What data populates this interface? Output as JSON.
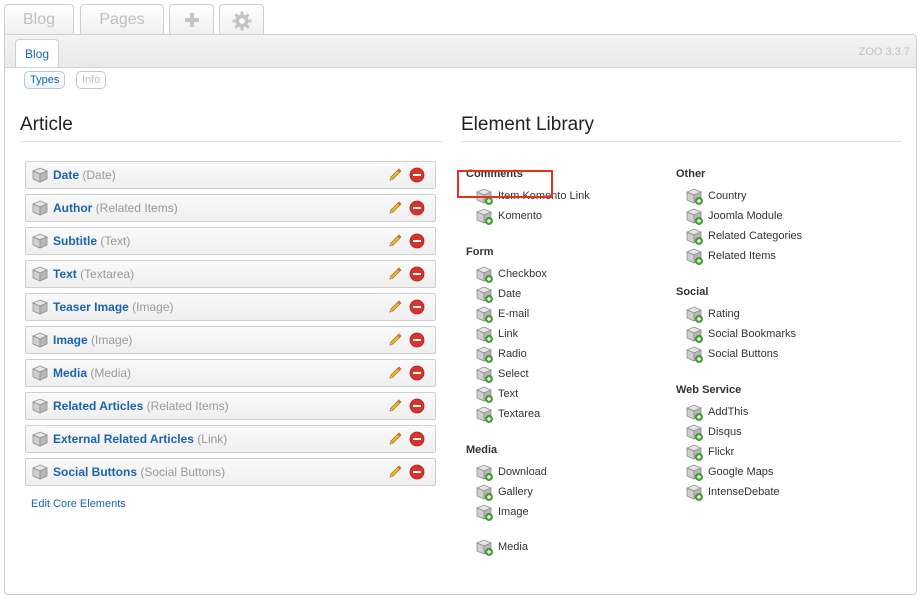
{
  "top_tabs": {
    "blog": "Blog",
    "pages": "Pages",
    "add_icon": "plus-icon",
    "settings_icon": "gear-icon"
  },
  "header": {
    "active_tab": "Blog",
    "version": "ZOO 3.3.7"
  },
  "subnav": {
    "types": "Types",
    "info": "Info"
  },
  "article": {
    "title": "Article",
    "rows": [
      {
        "name": "Date",
        "type": "(Date)"
      },
      {
        "name": "Author",
        "type": "(Related Items)"
      },
      {
        "name": "Subtitle",
        "type": "(Text)"
      },
      {
        "name": "Text",
        "type": "(Textarea)"
      },
      {
        "name": "Teaser Image",
        "type": "(Image)"
      },
      {
        "name": "Image",
        "type": "(Image)"
      },
      {
        "name": "Media",
        "type": "(Media)"
      },
      {
        "name": "Related Articles",
        "type": "(Related Items)"
      },
      {
        "name": "External Related Articles",
        "type": "(Link)"
      },
      {
        "name": "Social Buttons",
        "type": "(Social Buttons)"
      }
    ],
    "edit_core": "Edit Core Elements"
  },
  "library": {
    "title": "Element Library",
    "comments": {
      "heading": "Comments",
      "items": [
        "Item Komento Link",
        "Komento"
      ]
    },
    "form": {
      "heading": "Form",
      "items": [
        "Checkbox",
        "Date",
        "E-mail",
        "Link",
        "Radio",
        "Select",
        "Text",
        "Textarea"
      ]
    },
    "media": {
      "heading": "Media",
      "items": [
        "Download",
        "Gallery",
        "Image",
        "Media"
      ]
    },
    "other": {
      "heading": "Other",
      "items": [
        "Country",
        "Joomla Module",
        "Related Categories",
        "Related Items"
      ]
    },
    "social": {
      "heading": "Social",
      "items": [
        "Rating",
        "Social Bookmarks",
        "Social Buttons"
      ]
    },
    "webservice": {
      "heading": "Web Service",
      "items": [
        "AddThis",
        "Disqus",
        "Flickr",
        "Google Maps",
        "IntenseDebate"
      ]
    }
  },
  "colors": {
    "link": "#1a64b0",
    "highlight_border": "#e8311c",
    "delete": "#d9342b",
    "pencil": "#e8a317"
  }
}
